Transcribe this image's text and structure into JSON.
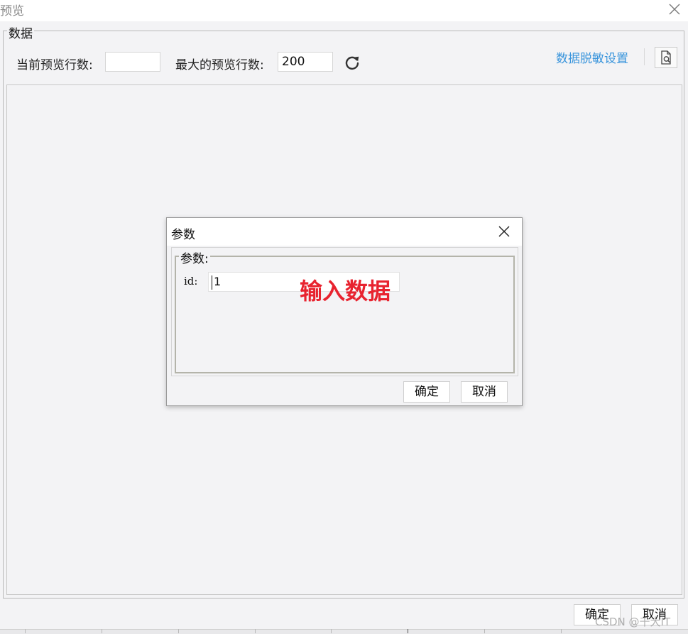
{
  "window": {
    "title": "预览",
    "close_icon": "close-icon"
  },
  "group": {
    "legend": "数据"
  },
  "toolbar": {
    "current_rows_label": "当前预览行数:",
    "current_rows_value": "",
    "max_rows_label": "最大的预览行数:",
    "max_rows_value": "200",
    "refresh_icon": "refresh-icon",
    "masking_link": "数据脱敏设置",
    "preview_icon": "document-search-icon"
  },
  "footer": {
    "ok_label": "确定",
    "cancel_label": "取消",
    "watermark": "CSDN @千大IT"
  },
  "param_dialog": {
    "title": "参数",
    "group_legend": "参数:",
    "id_label": "id:",
    "id_value": "1",
    "annotation": "输入数据",
    "ok_label": "确定",
    "cancel_label": "取消",
    "annotation_color": "#e8232f"
  },
  "colors": {
    "link": "#3a95dc",
    "background": "#f3f3f5"
  }
}
